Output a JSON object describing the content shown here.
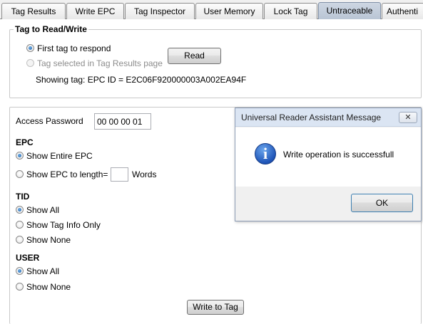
{
  "tabs": [
    {
      "label": "Tag Results",
      "active": false
    },
    {
      "label": "Write EPC",
      "active": false
    },
    {
      "label": "Tag Inspector",
      "active": false
    },
    {
      "label": "User Memory",
      "active": false
    },
    {
      "label": "Lock Tag",
      "active": false
    },
    {
      "label": "Untraceable",
      "active": true
    },
    {
      "label": "Authenti",
      "active": false
    }
  ],
  "tag_group": {
    "title": "Tag to Read/Write",
    "option_first": "First tag to respond",
    "option_selected": "Tag selected in Tag Results page",
    "read_button": "Read",
    "showing_tag": "Showing tag: EPC ID = E2C06F920000003A002EA94F"
  },
  "access": {
    "label": "Access Password",
    "value": "00 00 00 01"
  },
  "epc": {
    "title": "EPC",
    "show_entire": "Show Entire EPC",
    "show_length": "Show EPC to length=",
    "length_value": "",
    "words_label": "Words"
  },
  "tid": {
    "title": "TID",
    "show_all": "Show All",
    "show_info": "Show Tag Info Only",
    "show_none": "Show None"
  },
  "user": {
    "title": "USER",
    "show_all": "Show All",
    "show_none": "Show None"
  },
  "write_button": "Write to Tag",
  "dialog": {
    "title": "Universal Reader Assistant Message",
    "close_glyph": "✕",
    "icon_glyph": "i",
    "message": "Write operation is successfull",
    "ok_button": "OK"
  },
  "colors": {
    "active_tab": "#c3cedd",
    "radio_selected": "#1d5fa8",
    "dialog_titlebar": "#dbe5f3"
  }
}
